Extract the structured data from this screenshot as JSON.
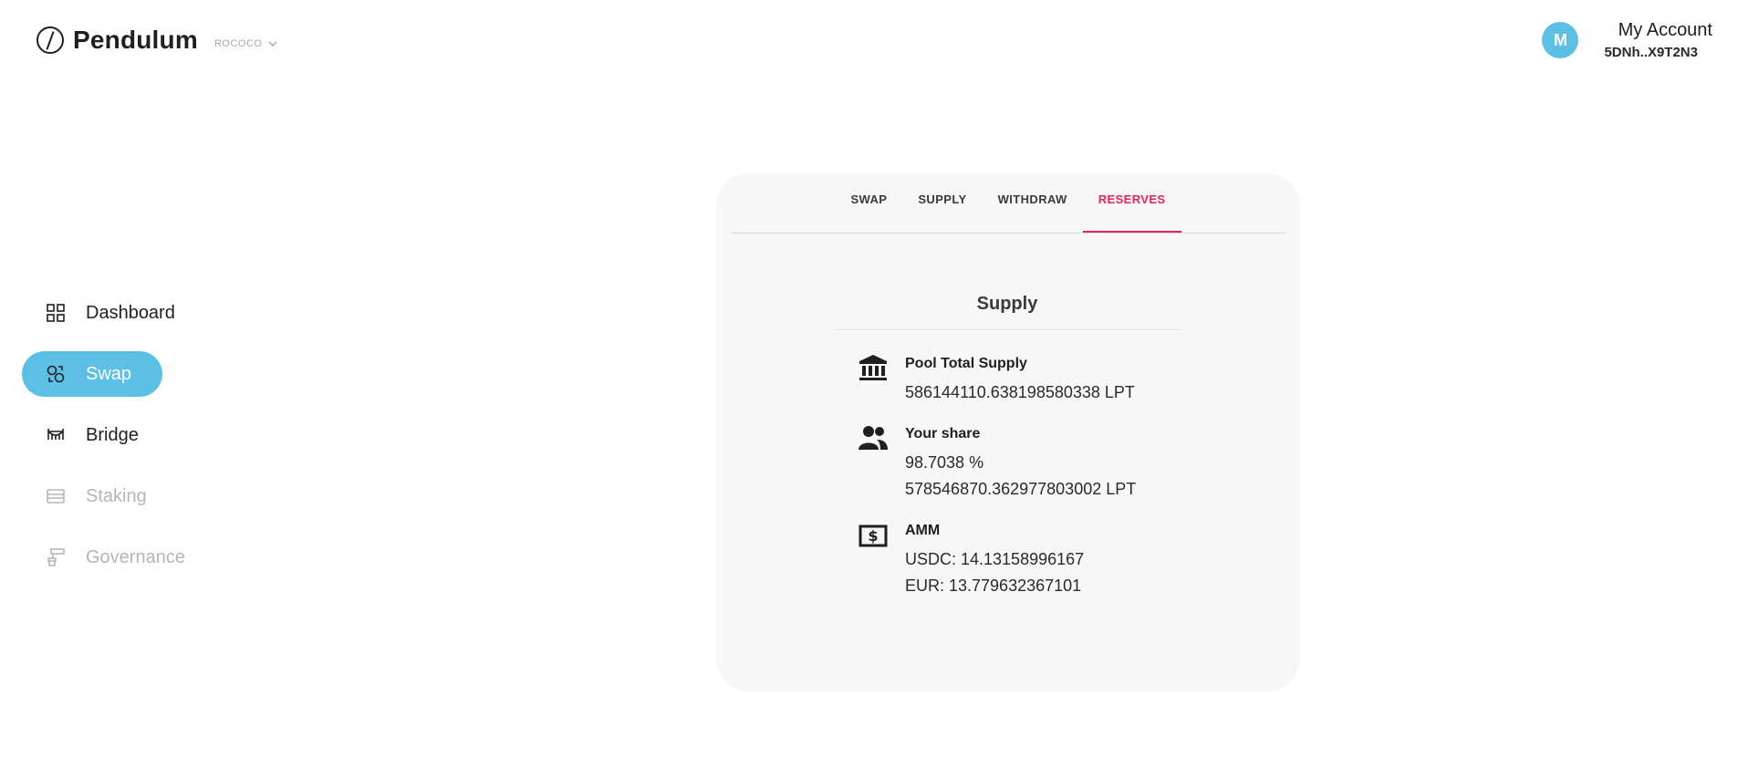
{
  "header": {
    "logo_text": "Pendulum",
    "network": "ROCOCO",
    "account_name": "My Account",
    "account_address": "5DNh..X9T2N3",
    "avatar_letter": "M"
  },
  "sidebar": {
    "items": [
      {
        "label": "Dashboard",
        "icon": "grid-icon",
        "state": "normal"
      },
      {
        "label": "Swap",
        "icon": "swap-icon",
        "state": "active"
      },
      {
        "label": "Bridge",
        "icon": "bridge-icon",
        "state": "normal"
      },
      {
        "label": "Staking",
        "icon": "staking-icon",
        "state": "disabled"
      },
      {
        "label": "Governance",
        "icon": "governance-icon",
        "state": "disabled"
      }
    ]
  },
  "card": {
    "tabs": [
      "SWAP",
      "SUPPLY",
      "WITHDRAW",
      "RESERVES"
    ],
    "active_tab": "RESERVES",
    "section_title": "Supply",
    "pool_total_supply": {
      "label": "Pool Total Supply",
      "value": "586144110.638198580338 LPT"
    },
    "your_share": {
      "label": "Your share",
      "percent": "98.7038 %",
      "amount": "578546870.362977803002 LPT"
    },
    "amm": {
      "label": "AMM",
      "usdc": "USDC: 14.13158996167",
      "eur": "EUR: 13.779632367101"
    }
  },
  "colors": {
    "accent": "#5bc0e3",
    "tab_active": "#e3255b",
    "card_bg": "#f7f7f7",
    "disabled_text": "#b5b5b5"
  }
}
